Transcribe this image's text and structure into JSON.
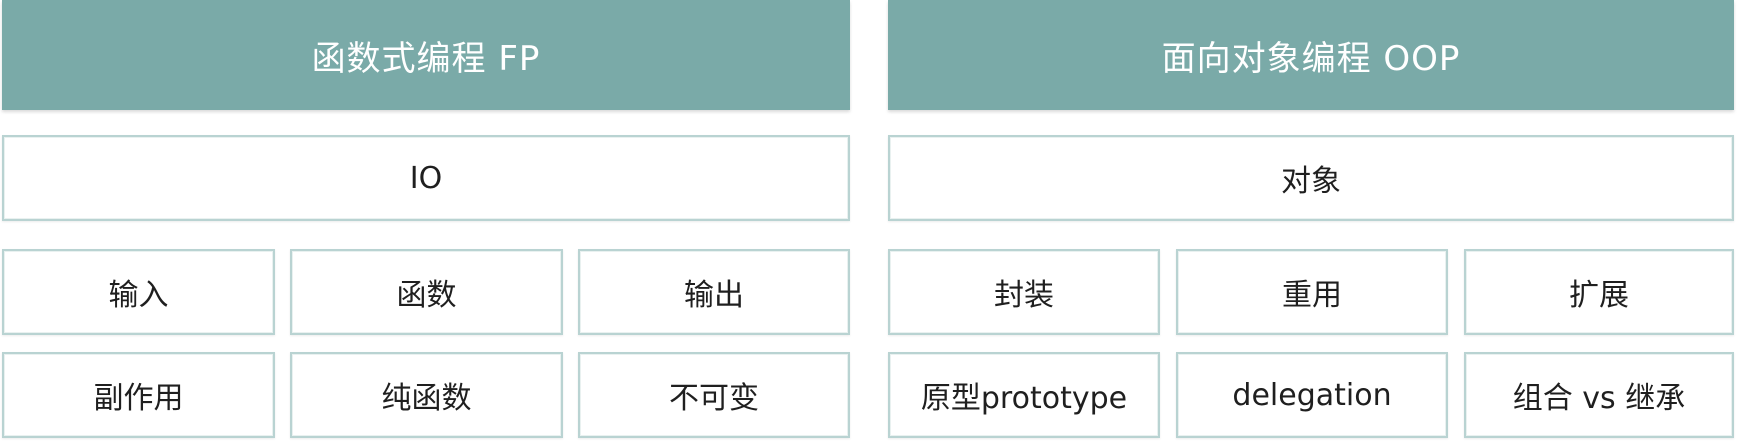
{
  "fp": {
    "title": "函数式编程 FP",
    "core": "IO",
    "row1": [
      "输入",
      "函数",
      "输出"
    ],
    "row2": [
      "副作用",
      "纯函数",
      "不可变"
    ]
  },
  "oop": {
    "title": "面向对象编程 OOP",
    "core": "对象",
    "row1": [
      "封装",
      "重用",
      "扩展"
    ],
    "row2": [
      "原型prototype",
      "delegation",
      "组合 vs 继承"
    ]
  },
  "colors": {
    "header_bg": "#7aaaa8",
    "box_border": "#b9d3d2",
    "text": "#1f1f1f"
  }
}
